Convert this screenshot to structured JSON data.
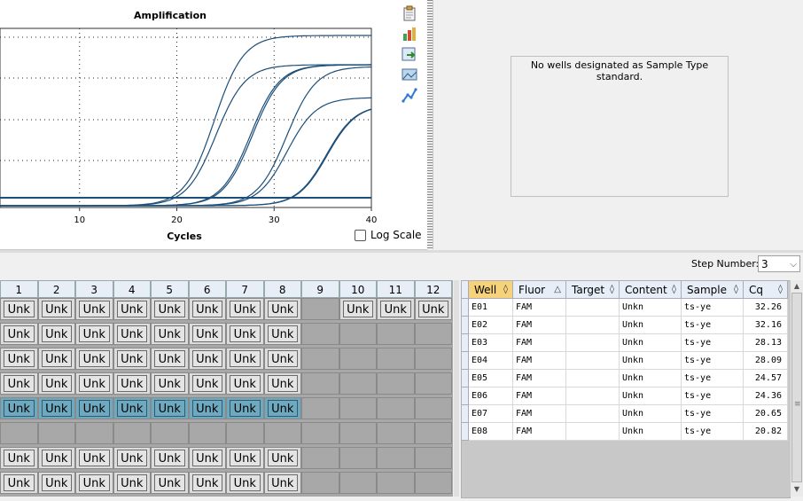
{
  "chart": {
    "title": "Amplification",
    "xlabel": "Cycles",
    "x_ticks": [
      "10",
      "20",
      "30",
      "40"
    ],
    "log_scale_label": "Log Scale",
    "log_scale_checked": false,
    "line_color": "#1d4f7a"
  },
  "chart_data": {
    "type": "line",
    "title": "Amplification",
    "xlabel": "Cycles",
    "ylabel": "",
    "xlim": [
      1,
      40
    ],
    "grid": true,
    "legend": "none",
    "series": [
      {
        "threshold_cycle": 20.65
      },
      {
        "threshold_cycle": 20.82
      },
      {
        "threshold_cycle": 24.36
      },
      {
        "threshold_cycle": 24.57
      },
      {
        "threshold_cycle": 28.09
      },
      {
        "threshold_cycle": 28.13
      },
      {
        "threshold_cycle": 32.16
      },
      {
        "threshold_cycle": 32.26
      }
    ]
  },
  "toolbar": {
    "icons": [
      "clipboard-icon",
      "chart-settings-icon",
      "export-icon",
      "image-icon",
      "trend-icon"
    ]
  },
  "standard_curve": {
    "message": "No wells designated as Sample Type standard."
  },
  "step": {
    "label": "Step Number:",
    "value": "3"
  },
  "plate": {
    "columns": [
      "1",
      "2",
      "3",
      "4",
      "5",
      "6",
      "7",
      "8",
      "9",
      "10",
      "11",
      "12"
    ],
    "well_label": "Unk",
    "rows": [
      [
        1,
        1,
        1,
        1,
        1,
        1,
        1,
        1,
        0,
        1,
        1,
        1
      ],
      [
        1,
        1,
        1,
        1,
        1,
        1,
        1,
        1,
        0,
        0,
        0,
        0
      ],
      [
        1,
        1,
        1,
        1,
        1,
        1,
        1,
        1,
        0,
        0,
        0,
        0
      ],
      [
        1,
        1,
        1,
        1,
        1,
        1,
        1,
        1,
        0,
        0,
        0,
        0
      ],
      [
        2,
        2,
        2,
        2,
        2,
        2,
        2,
        2,
        0,
        0,
        0,
        0
      ],
      [
        0,
        0,
        0,
        0,
        0,
        0,
        0,
        0,
        0,
        0,
        0,
        0
      ],
      [
        1,
        1,
        1,
        1,
        1,
        1,
        1,
        1,
        0,
        0,
        0,
        0
      ],
      [
        1,
        1,
        1,
        1,
        1,
        1,
        1,
        1,
        0,
        0,
        0,
        0
      ]
    ],
    "selected_color": "#6fa9c0"
  },
  "table": {
    "headers": [
      {
        "label": "Well",
        "sort": "◊"
      },
      {
        "label": "Fluor",
        "sort": "△"
      },
      {
        "label": "Target",
        "sort": "◊"
      },
      {
        "label": "Content",
        "sort": "◊"
      },
      {
        "label": "Sample",
        "sort": "◊"
      },
      {
        "label": "Cq",
        "sort": "◊"
      }
    ],
    "rows": [
      [
        "E01",
        "FAM",
        "",
        "Unkn",
        "ts-ye",
        "32.26"
      ],
      [
        "E02",
        "FAM",
        "",
        "Unkn",
        "ts-ye",
        "32.16"
      ],
      [
        "E03",
        "FAM",
        "",
        "Unkn",
        "ts-ye",
        "28.13"
      ],
      [
        "E04",
        "FAM",
        "",
        "Unkn",
        "ts-ye",
        "28.09"
      ],
      [
        "E05",
        "FAM",
        "",
        "Unkn",
        "ts-ye",
        "24.57"
      ],
      [
        "E06",
        "FAM",
        "",
        "Unkn",
        "ts-ye",
        "24.36"
      ],
      [
        "E07",
        "FAM",
        "",
        "Unkn",
        "ts-ye",
        "20.65"
      ],
      [
        "E08",
        "FAM",
        "",
        "Unkn",
        "ts-ye",
        "20.82"
      ]
    ],
    "active_header_color": "#f6d27a"
  }
}
